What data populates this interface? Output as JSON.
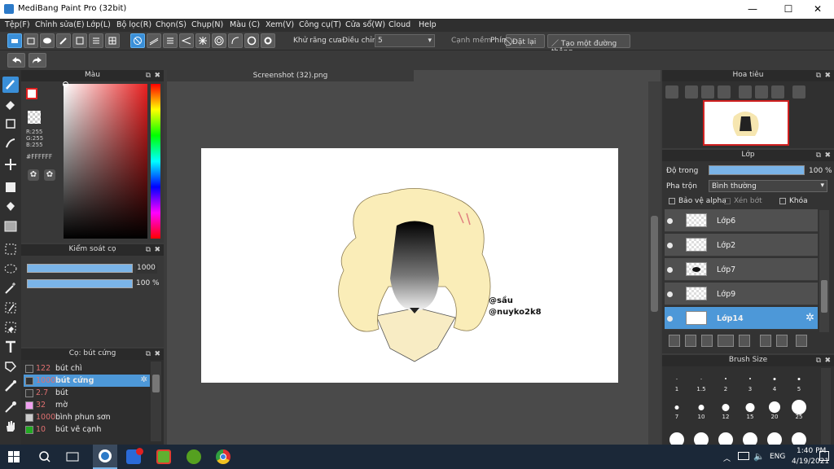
{
  "window": {
    "title": "MediBang Paint Pro (32bit)"
  },
  "menu": [
    "Tệp(F)",
    "Chỉnh sửa(E)",
    "Lớp(L)",
    "Bộ lọc(R)",
    "Chọn(S)",
    "Chụp(N)",
    "Màu (C)",
    "Xem(V)",
    "Công cụ(T)",
    "Cửa sổ(W)",
    "Cloud",
    "Help"
  ],
  "toolbar": {
    "antialias_label": "Khử răng cưa",
    "adjust_label": "Điều chỉnh",
    "adjust_value": "5",
    "soft_edge_label": "Cạnh mềm",
    "key_label": "Phím",
    "reset_label": "Đặt lại",
    "straight_line_label": "Tạo một đường thẳng"
  },
  "color_panel": {
    "title": "Màu",
    "r": "R:255",
    "g": "G:255",
    "b": "B:255",
    "hex": "#FFFFFF"
  },
  "brush_control": {
    "title": "Kiểm soát cọ",
    "size": "1000",
    "opacity": "100 %"
  },
  "brush_list": {
    "title": "Cọ: bút cứng",
    "items": [
      {
        "value": "122",
        "name": "bút chì",
        "color": "#333333"
      },
      {
        "value": "1000",
        "name": "bút cứng",
        "color": "#333333"
      },
      {
        "value": "2.7",
        "name": "bút",
        "color": "#333333"
      },
      {
        "value": "32",
        "name": "mờ",
        "color": "#f0a0f0"
      },
      {
        "value": "1000",
        "name": "bình phun sơn",
        "color": "#cccccc"
      },
      {
        "value": "10",
        "name": "bút vẽ cạnh",
        "color": "#22aa22"
      }
    ]
  },
  "document": {
    "tab": "Screenshot (32).png",
    "watermark_line1": "@sầu",
    "watermark_line2": "@nuyko2k8"
  },
  "navigator": {
    "title": "Hoa tiêu"
  },
  "layers_panel": {
    "title": "Lớp",
    "opacity_label": "Độ trong",
    "opacity_value": "100 %",
    "opacity_fraction": 1.0,
    "blend_label": "Pha trộn",
    "blend_value": "Bình thường",
    "protect_alpha": "Bảo vệ alpha",
    "clip": "Xén bớt",
    "lock": "Khóa",
    "layers": [
      "Lớp6",
      "Lớp2",
      "Lớp7",
      "Lớp9",
      "Lớp14"
    ]
  },
  "brush_size": {
    "title": "Brush Size",
    "row1": [
      "1",
      "1.5",
      "2",
      "3",
      "4",
      "5"
    ],
    "row2": [
      "7",
      "10",
      "12",
      "15",
      "20",
      "25"
    ]
  },
  "taskbar": {
    "lang": "ENG",
    "time": "1:40 PM",
    "date": "4/19/2021"
  }
}
